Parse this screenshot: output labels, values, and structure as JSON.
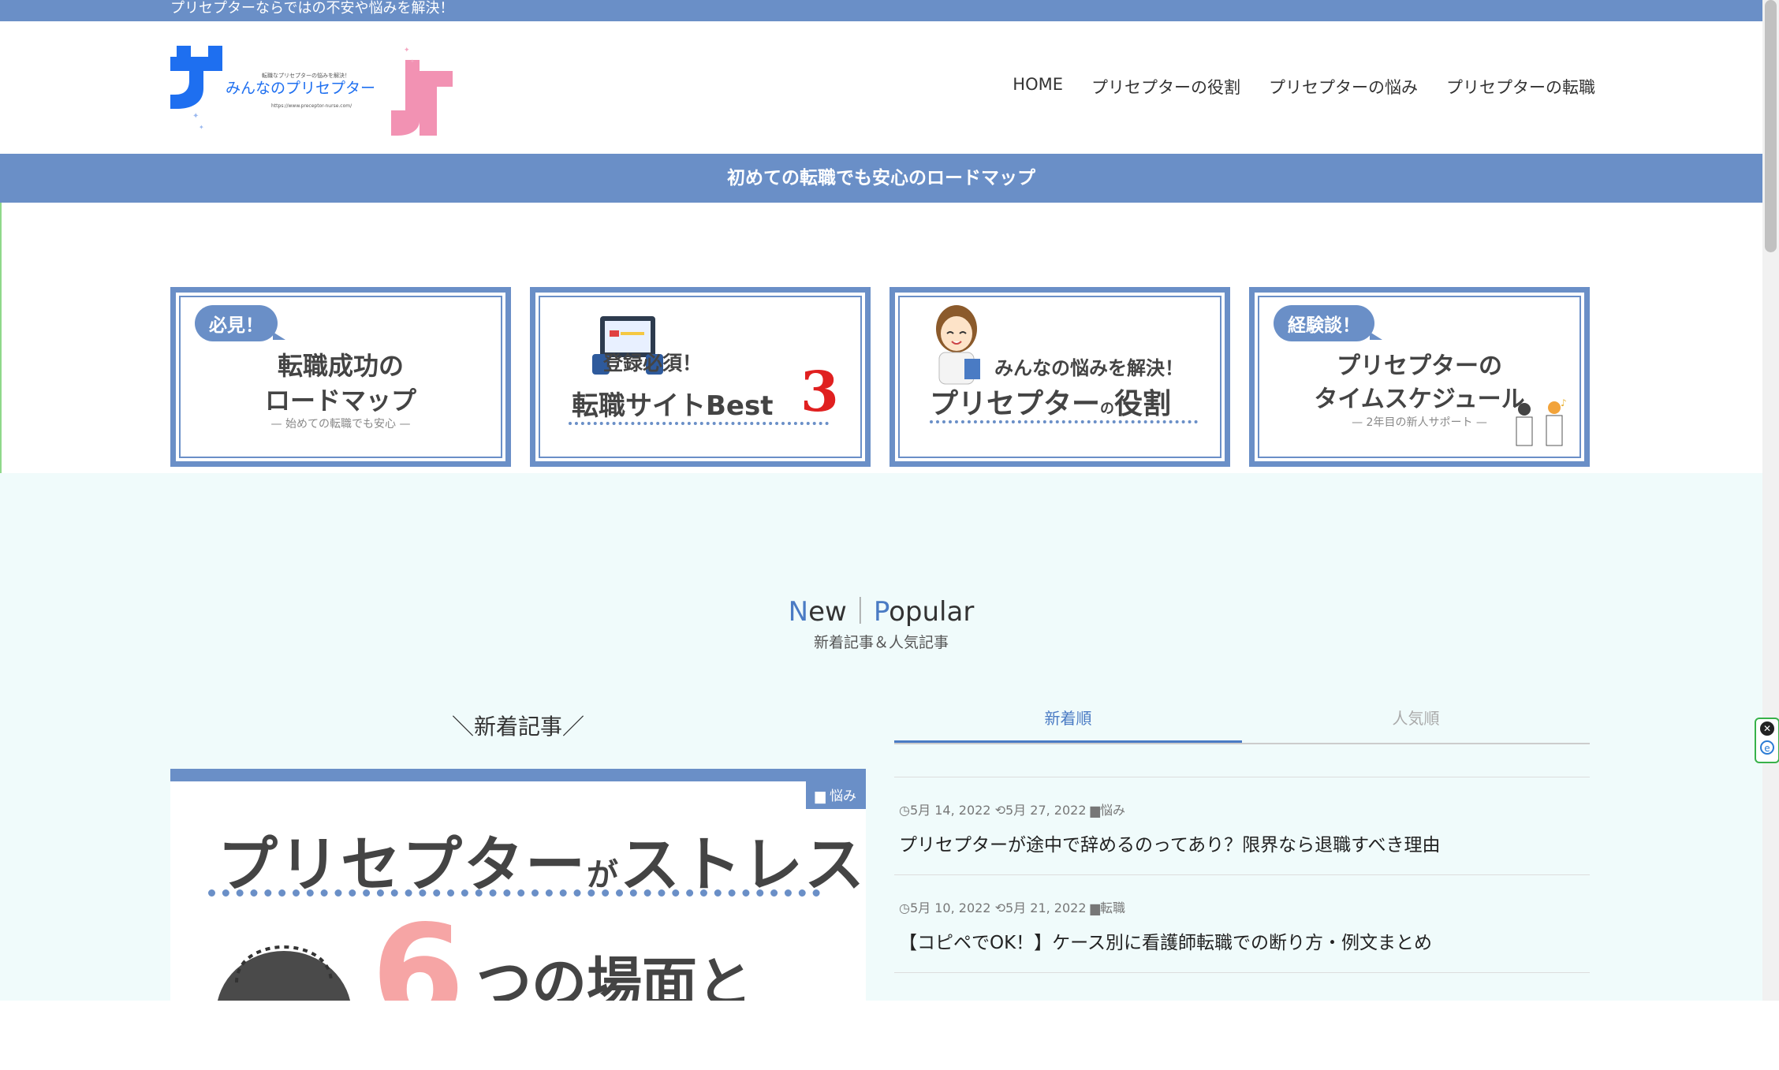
{
  "topbar": {
    "tagline": "プリセプターならではの不安や悩みを解決！"
  },
  "logo": {
    "text": "みんなのプリセプター",
    "tiny_text": "転職なプリセプターの悩みを解決！",
    "url_text": "https://www.preceptor-nurse.com/"
  },
  "nav": [
    {
      "label": "HOME"
    },
    {
      "label": "プリセプターの役割"
    },
    {
      "label": "プリセプターの悩み"
    },
    {
      "label": "プリセプターの転職"
    }
  ],
  "banner": {
    "text": "初めての転職でも安心のロードマップ"
  },
  "cards": [
    {
      "badge": "必見！",
      "line1": "転職成功の",
      "line2": "ロードマップ",
      "sub": "— 始めての転職でも安心 —"
    },
    {
      "line1": "登録必須！",
      "line2": "転職サイトBest",
      "num": "3"
    },
    {
      "line1": "みんなの悩みを解決！",
      "line2": "プリセプター",
      "small": "の",
      "line3": "役割"
    },
    {
      "badge": "経験談！",
      "line1": "プリセプターの",
      "line2": "タイムスケジュール",
      "sub": "— 2年目の新人サポート —"
    }
  ],
  "section": {
    "title_n": "N",
    "title_ew": "ew",
    "sep": "｜",
    "title_p": "P",
    "title_opular": "opular",
    "subtitle": "新着記事＆人気記事"
  },
  "new_heading": "＼新着記事／",
  "featured": {
    "category": "悩み",
    "title_a": "プリセプター",
    "title_small": "が",
    "title_b": "ストレス",
    "six": "6",
    "sub": "つの場面と"
  },
  "tabs": [
    {
      "label": "新着順"
    },
    {
      "label": "人気順"
    }
  ],
  "articles": [
    {
      "posted": "5月 14, 2022",
      "updated": "5月 27, 2022",
      "category": "悩み",
      "title": "プリセプターが途中で辞めるのってあり？限界なら退職すべき理由"
    },
    {
      "posted": "5月 10, 2022",
      "updated": "5月 21, 2022",
      "category": "転職",
      "title": "【コピペでOK！】ケース別に看護師転職での断り方・例文まとめ"
    }
  ],
  "colors": {
    "accent": "#6a8fc7",
    "mint": "#f0fbfb",
    "pink": "#f07fa6"
  }
}
